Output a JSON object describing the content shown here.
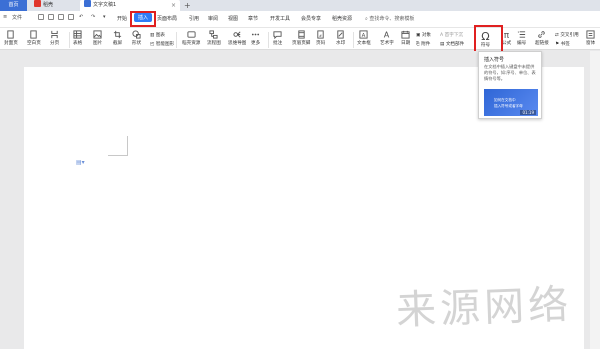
{
  "tabs": {
    "home": "首页",
    "mold": "稻壳",
    "doc": "文字文稿1",
    "new_tab": "+"
  },
  "menu": {
    "hamburger": "≡",
    "file": "文件",
    "items": [
      "开始",
      "插入",
      "页面布局",
      "引用",
      "审阅",
      "视图",
      "章节",
      "开发工具",
      "会员专享",
      "稻壳资源"
    ],
    "active": "插入",
    "search": "查找命令、搜索模板"
  },
  "ribbon": {
    "cover": "封面页",
    "blank": "空白页",
    "pagebreak": "分页",
    "table": "表格",
    "picture": "图片",
    "screenshot": "截屏",
    "shape": "形状",
    "icon": "图标",
    "chart": "图表",
    "smartart": "智能图形",
    "mold_material": "稻壳资源",
    "flowchart": "流程图",
    "mindmap": "思维导图",
    "more": "更多",
    "comment": "批注",
    "header_footer": "页眉页脚",
    "page_number": "页码",
    "watermark": "水印",
    "textbox": "文本框",
    "wordart": "艺术字",
    "date": "日期",
    "object": "对象",
    "first_drop": "首字下沉",
    "attachment": "附件",
    "doc_part": "文档部件",
    "symbol": "符号",
    "formula": "公式",
    "numbering": "编号",
    "hyperlink": "超链接",
    "crossref": "交叉引用",
    "bookmark": "书签",
    "form": "窗体"
  },
  "tooltip": {
    "title": "插入符号",
    "desc": "在文档中插入键盘中未提供的符号，如:序号、单位、表情符号等。",
    "video_line1": "如何在文档中",
    "video_line2": "插入符号或者字母",
    "time": "01:19"
  },
  "watermark_text": "来源网络",
  "colors": {
    "accent": "#2f7cf6",
    "highlight": "#e02020",
    "home_tab": "#3b6fd5"
  }
}
